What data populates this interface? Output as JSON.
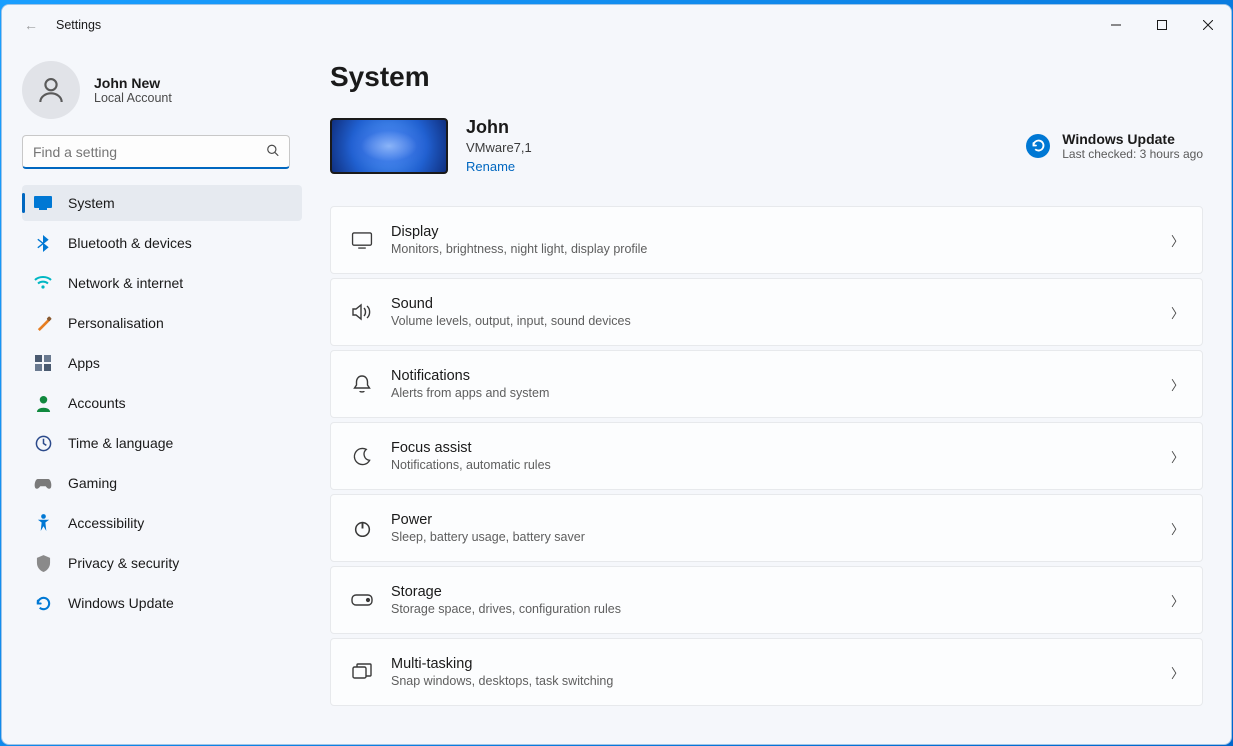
{
  "app": {
    "title": "Settings"
  },
  "user": {
    "name": "John New",
    "sub": "Local Account"
  },
  "search": {
    "placeholder": "Find a setting"
  },
  "sidebar": {
    "items": [
      {
        "label": "System"
      },
      {
        "label": "Bluetooth & devices"
      },
      {
        "label": "Network & internet"
      },
      {
        "label": "Personalisation"
      },
      {
        "label": "Apps"
      },
      {
        "label": "Accounts"
      },
      {
        "label": "Time & language"
      },
      {
        "label": "Gaming"
      },
      {
        "label": "Accessibility"
      },
      {
        "label": "Privacy & security"
      },
      {
        "label": "Windows Update"
      }
    ]
  },
  "page": {
    "title": "System"
  },
  "pc": {
    "name": "John",
    "model": "VMware7,1",
    "rename": "Rename"
  },
  "update": {
    "title": "Windows Update",
    "sub": "Last checked: 3 hours ago"
  },
  "cards": [
    {
      "title": "Display",
      "sub": "Monitors, brightness, night light, display profile"
    },
    {
      "title": "Sound",
      "sub": "Volume levels, output, input, sound devices"
    },
    {
      "title": "Notifications",
      "sub": "Alerts from apps and system"
    },
    {
      "title": "Focus assist",
      "sub": "Notifications, automatic rules"
    },
    {
      "title": "Power",
      "sub": "Sleep, battery usage, battery saver"
    },
    {
      "title": "Storage",
      "sub": "Storage space, drives, configuration rules"
    },
    {
      "title": "Multi-tasking",
      "sub": "Snap windows, desktops, task switching"
    }
  ]
}
